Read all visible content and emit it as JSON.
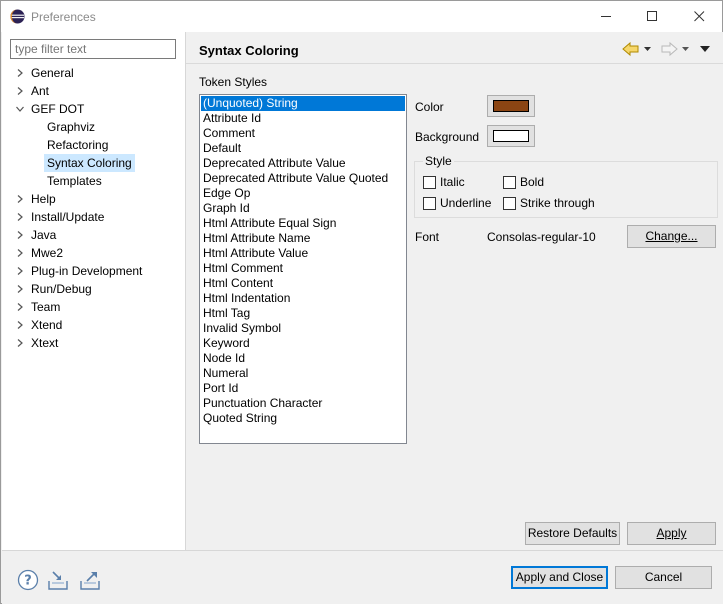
{
  "window": {
    "title": "Preferences",
    "controls": [
      "minimize-icon",
      "maximize-icon",
      "close-icon"
    ]
  },
  "sidebar": {
    "filter_placeholder": "type filter text",
    "items": [
      {
        "label": "General",
        "expandable": true,
        "expanded": false,
        "level": 0
      },
      {
        "label": "Ant",
        "expandable": true,
        "expanded": false,
        "level": 0
      },
      {
        "label": "GEF DOT",
        "expandable": true,
        "expanded": true,
        "level": 0
      },
      {
        "label": "Graphviz",
        "expandable": false,
        "level": 1
      },
      {
        "label": "Refactoring",
        "expandable": false,
        "level": 1
      },
      {
        "label": "Syntax Coloring",
        "expandable": false,
        "level": 1,
        "selected": true
      },
      {
        "label": "Templates",
        "expandable": false,
        "level": 1
      },
      {
        "label": "Help",
        "expandable": true,
        "expanded": false,
        "level": 0
      },
      {
        "label": "Install/Update",
        "expandable": true,
        "expanded": false,
        "level": 0
      },
      {
        "label": "Java",
        "expandable": true,
        "expanded": false,
        "level": 0
      },
      {
        "label": "Mwe2",
        "expandable": true,
        "expanded": false,
        "level": 0
      },
      {
        "label": "Plug-in Development",
        "expandable": true,
        "expanded": false,
        "level": 0
      },
      {
        "label": "Run/Debug",
        "expandable": true,
        "expanded": false,
        "level": 0
      },
      {
        "label": "Team",
        "expandable": true,
        "expanded": false,
        "level": 0
      },
      {
        "label": "Xtend",
        "expandable": true,
        "expanded": false,
        "level": 0
      },
      {
        "label": "Xtext",
        "expandable": true,
        "expanded": false,
        "level": 0
      }
    ]
  },
  "page": {
    "title": "Syntax Coloring",
    "nav_icons": [
      "back-arrow-icon",
      "back-menu-icon",
      "forward-arrow-icon",
      "forward-menu-icon",
      "view-menu-icon"
    ],
    "token_styles_label": "Token Styles",
    "tokens": [
      "(Unquoted) String",
      "Attribute Id",
      "Comment",
      "Default",
      "Deprecated Attribute Value",
      "Deprecated Attribute Value Quoted",
      "Edge Op",
      "Graph Id",
      "Html Attribute Equal Sign",
      "Html Attribute Name",
      "Html Attribute Value",
      "Html Comment",
      "Html Content",
      "Html Indentation",
      "Html Tag",
      "Invalid Symbol",
      "Keyword",
      "Node Id",
      "Numeral",
      "Port Id",
      "Punctuation Character",
      "Quoted String"
    ],
    "selected_token": "(Unquoted) String",
    "color_label": "Color",
    "color_value": "#8b4513",
    "background_label": "Background",
    "background_value": "#ffffff",
    "style_label": "Style",
    "italic_label": "Italic",
    "bold_label": "Bold",
    "underline_label": "Underline",
    "strike_label": "Strike through",
    "italic_checked": false,
    "bold_checked": false,
    "underline_checked": false,
    "strike_checked": false,
    "font_label": "Font",
    "font_value": "Consolas-regular-10",
    "change_button": "Change...",
    "restore_defaults_button": "Restore Defaults",
    "apply_button": "Apply"
  },
  "footer": {
    "icons": [
      "help-icon",
      "import-icon",
      "export-icon"
    ],
    "apply_close_button": "Apply and Close",
    "cancel_button": "Cancel"
  },
  "colors": {
    "selection": "#0078d7",
    "tree_selection": "#cce8ff",
    "accent_nav": "#e8b800"
  }
}
